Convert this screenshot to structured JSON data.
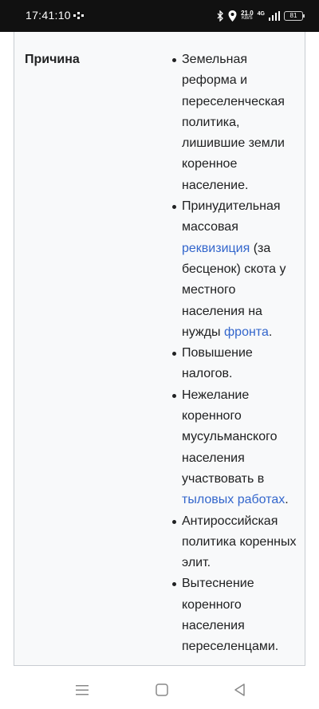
{
  "status_bar": {
    "time": "17:41:10",
    "net_speed": "21.0",
    "net_speed_unit": "KB/S",
    "network_type": "4G",
    "battery": "81"
  },
  "infobox": {
    "label": "Причина",
    "items": [
      {
        "parts": [
          {
            "text": "Земельная реформа и переселенческая политика, лишившие земли коренное население.",
            "link": false
          }
        ]
      },
      {
        "parts": [
          {
            "text": "Принудительная массовая ",
            "link": false
          },
          {
            "text": "реквизиция",
            "link": true
          },
          {
            "text": " (за бесценок) скота у местного населения на нужды ",
            "link": false
          },
          {
            "text": "фронта",
            "link": true
          },
          {
            "text": ".",
            "link": false
          }
        ]
      },
      {
        "parts": [
          {
            "text": "Повышение налогов.",
            "link": false
          }
        ]
      },
      {
        "parts": [
          {
            "text": "Нежелание коренного мусульманского населения участвовать в ",
            "link": false
          },
          {
            "text": "тыловых работах",
            "link": true
          },
          {
            "text": ".",
            "link": false
          }
        ]
      },
      {
        "parts": [
          {
            "text": "Антироссийская политика коренных элит.",
            "link": false
          }
        ]
      },
      {
        "parts": [
          {
            "text": "Вытеснение коренного населения переселенцами.",
            "link": false
          }
        ]
      }
    ]
  },
  "colors": {
    "link": "#3366cc",
    "text": "#202122",
    "infobox_bg": "#f8f9fa",
    "border": "#c8ccd1"
  }
}
